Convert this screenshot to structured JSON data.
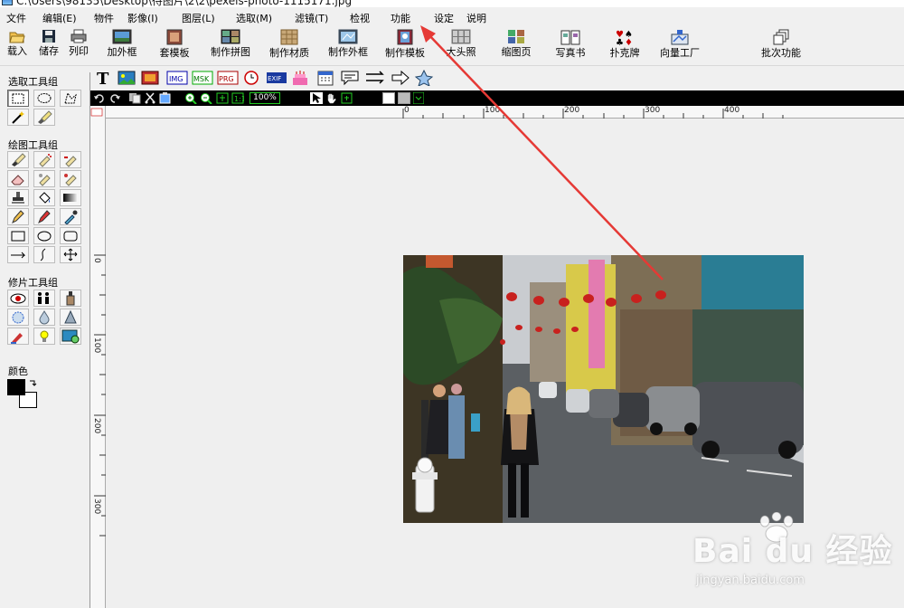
{
  "window": {
    "title": "C:\\Users\\98135\\Desktop\\待图片\\2\\2\\pexels-photo-1115171.jpg"
  },
  "menu": [
    {
      "label": "文件"
    },
    {
      "label": "编辑(E)"
    },
    {
      "label": "物件"
    },
    {
      "label": "影像(I)"
    },
    {
      "label": "图层(L)"
    },
    {
      "label": "选取(M)"
    },
    {
      "label": "滤镜(T)"
    },
    {
      "label": "检视"
    },
    {
      "label": "功能"
    },
    {
      "label": "设定"
    },
    {
      "label": "说明"
    }
  ],
  "toolbar": [
    {
      "label": "载入",
      "icon": "folder-open-icon"
    },
    {
      "label": "储存",
      "icon": "floppy-disk-icon"
    },
    {
      "label": "列印",
      "icon": "printer-icon"
    },
    {
      "label": "加外框",
      "icon": "frame-icon"
    },
    {
      "label": "套模板",
      "icon": "template-icon"
    },
    {
      "label": "制作拼图",
      "icon": "collage-icon"
    },
    {
      "label": "制作材质",
      "icon": "texture-icon"
    },
    {
      "label": "制作外框",
      "icon": "make-frame-icon"
    },
    {
      "label": "制作模板",
      "icon": "make-template-icon"
    },
    {
      "label": "大头照",
      "icon": "id-photo-icon"
    },
    {
      "label": "缩图页",
      "icon": "thumbnail-page-icon"
    },
    {
      "label": "写真书",
      "icon": "photo-book-icon"
    },
    {
      "label": "扑克牌",
      "icon": "playing-cards-icon"
    },
    {
      "label": "向量工厂",
      "icon": "vector-factory-icon"
    },
    {
      "label": "批次功能",
      "icon": "batch-icon"
    }
  ],
  "zoom": "100%",
  "panels": {
    "select_group": "选取工具组",
    "draw_group": "绘图工具组",
    "retouch_group": "修片工具组",
    "color": "颜色"
  },
  "ruler": {
    "h": [
      "0",
      "100",
      "200",
      "300",
      "400"
    ],
    "v": [
      "0",
      "100",
      "200",
      "300"
    ]
  },
  "watermark": {
    "brand": "Bai du 经验",
    "url": "jingyan.baidu.com"
  },
  "colors": {
    "annotation_arrow": "#e53935",
    "foreground": "#000000",
    "background": "#ffffff"
  }
}
